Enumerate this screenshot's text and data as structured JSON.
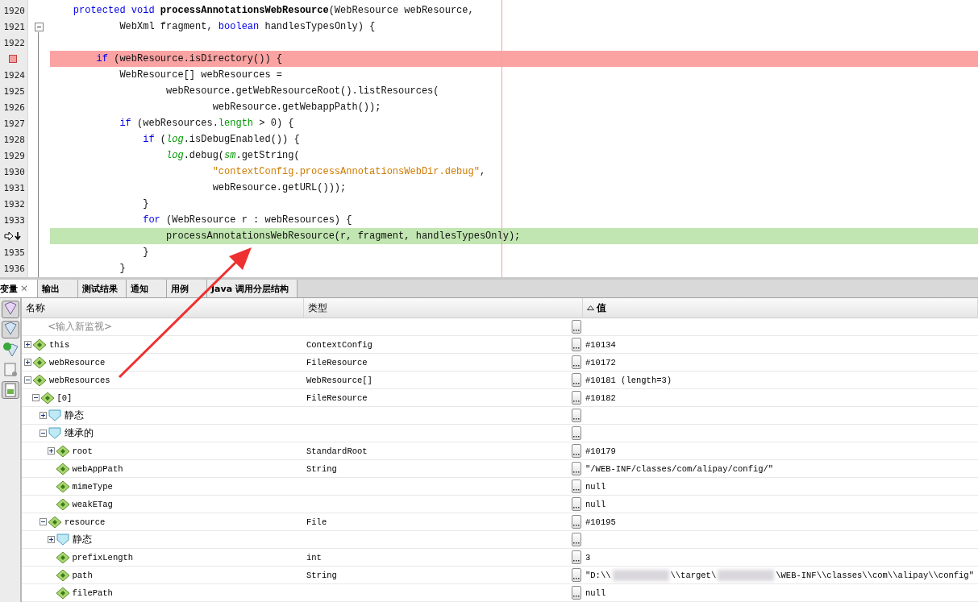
{
  "editor": {
    "lines": [
      {
        "number": "1920",
        "kind": "normal",
        "fold": false,
        "tokens": [
          {
            "kind": "keyword",
            "s": "    protected void "
          },
          {
            "kind": "bold",
            "s": "processAnnotationsWebResource"
          },
          {
            "kind": "plain",
            "s": "(WebResource webResource,"
          }
        ]
      },
      {
        "number": "1921",
        "kind": "normal",
        "fold": true,
        "tokens": [
          {
            "kind": "plain",
            "s": "            WebXml fragment, "
          },
          {
            "kind": "keyword",
            "s": "boolean"
          },
          {
            "kind": "plain",
            "s": " handlesTypesOnly) {"
          }
        ]
      },
      {
        "number": "1922",
        "kind": "normal"
      },
      {
        "kind": "breakpoint",
        "fold": false,
        "tokens": [
          {
            "kind": "keyword",
            "s": "        if"
          },
          {
            "kind": "plain",
            "s": " (webResource.isDirectory()) {"
          }
        ]
      },
      {
        "number": "1924",
        "kind": "normal",
        "fold": false,
        "tokens": [
          {
            "kind": "plain",
            "s": "            WebResource[] webResources ="
          }
        ]
      },
      {
        "number": "1925",
        "kind": "normal",
        "fold": false,
        "tokens": [
          {
            "kind": "plain",
            "s": "                    webResource.getWebResourceRoot().listResources("
          }
        ]
      },
      {
        "number": "1926",
        "kind": "normal",
        "fold": false,
        "tokens": [
          {
            "kind": "plain",
            "s": "                            webResource.getWebappPath());"
          }
        ]
      },
      {
        "number": "1927",
        "kind": "normal",
        "fold": false,
        "tokens": [
          {
            "kind": "keyword",
            "s": "            if"
          },
          {
            "kind": "plain",
            "s": " (webResources."
          },
          {
            "kind": "field",
            "s": "length"
          },
          {
            "kind": "plain",
            "s": " > 0) {"
          }
        ]
      },
      {
        "number": "1928",
        "kind": "normal",
        "fold": false,
        "tokens": [
          {
            "kind": "keyword",
            "s": "                if"
          },
          {
            "kind": "plain",
            "s": " ("
          },
          {
            "kind": "static",
            "s": "log"
          },
          {
            "kind": "plain",
            "s": ".isDebugEnabled()) {"
          }
        ]
      },
      {
        "number": "1929",
        "kind": "normal",
        "fold": false,
        "tokens": [
          {
            "kind": "static",
            "s": "                    log"
          },
          {
            "kind": "plain",
            "s": ".debug("
          },
          {
            "kind": "static",
            "s": "sm"
          },
          {
            "kind": "plain",
            "s": ".getString("
          }
        ]
      },
      {
        "number": "1930",
        "kind": "normal",
        "fold": false,
        "tokens": [
          {
            "kind": "string",
            "s": "                            \"contextConfig.processAnnotationsWebDir.debug\""
          },
          {
            "kind": "plain",
            "s": ","
          }
        ]
      },
      {
        "number": "1931",
        "kind": "normal",
        "fold": false,
        "tokens": [
          {
            "kind": "plain",
            "s": "                            webResource.getURL()));"
          }
        ]
      },
      {
        "number": "1932",
        "kind": "normal",
        "fold": false,
        "tokens": [
          {
            "kind": "plain",
            "s": "                }"
          }
        ]
      },
      {
        "number": "1933",
        "kind": "normal",
        "fold": false,
        "tokens": [
          {
            "kind": "keyword",
            "s": "                for"
          },
          {
            "kind": "plain",
            "s": " (WebResource r : webResources) {"
          }
        ]
      },
      {
        "kind": "current",
        "fold": false,
        "tokens": [
          {
            "kind": "plain",
            "s": "                    processAnnotationsWebResource(r, fragment, handlesTypesOnly);"
          }
        ]
      },
      {
        "number": "1935",
        "kind": "normal",
        "fold": false,
        "tokens": [
          {
            "kind": "plain",
            "s": "                }"
          }
        ]
      },
      {
        "number": "1936",
        "kind": "normal",
        "fold": false,
        "tokens": [
          {
            "kind": "plain",
            "s": "            }"
          }
        ]
      }
    ]
  },
  "tabs": [
    {
      "label": "变量",
      "selected": true,
      "closable": true
    },
    {
      "label": "输出",
      "selected": false,
      "closable": false
    },
    {
      "label": "测试结果",
      "selected": false,
      "closable": false
    },
    {
      "label": "通知",
      "selected": false,
      "closable": false
    },
    {
      "label": "用例",
      "selected": false,
      "closable": false
    },
    {
      "label": "Java 调用分层结构",
      "selected": false,
      "closable": false
    }
  ],
  "table": {
    "columns": [
      {
        "label": "名称",
        "sorted": false
      },
      {
        "label": "类型",
        "sorted": false
      },
      {
        "label": "值",
        "sorted": true
      }
    ],
    "rows": [
      {
        "kind": "new_watch",
        "name": "<输入新监视>"
      },
      {
        "kind": "variable",
        "name": "this",
        "type": "ContextConfig",
        "value": "#10134",
        "expanded": false
      },
      {
        "kind": "variable",
        "name": "webResource",
        "type": "FileResource",
        "value": "#10172",
        "expanded": false
      },
      {
        "kind": "variable",
        "name": "webResources",
        "type": "WebResource[]",
        "value": "#10181 (length=3)",
        "expanded": true,
        "children": [
          {
            "kind": "variable",
            "name": "[0]",
            "type": "FileResource",
            "value": "#10182",
            "expanded": true,
            "children": [
              {
                "kind": "category",
                "name": "静态",
                "expanded": false
              },
              {
                "kind": "category",
                "name": "继承的",
                "expanded": true,
                "children": [
                  {
                    "kind": "variable",
                    "name": "root",
                    "type": "StandardRoot",
                    "value": "#10179",
                    "expanded": false
                  },
                  {
                    "kind": "variable",
                    "name": "webAppPath",
                    "type": "String",
                    "value": "\"/WEB-INF/classes/com/alipay/config/\""
                  },
                  {
                    "kind": "variable",
                    "name": "mimeType",
                    "value": "null"
                  },
                  {
                    "kind": "variable",
                    "name": "weakETag",
                    "value": "null"
                  }
                ]
              },
              {
                "kind": "variable",
                "name": "resource",
                "type": "File",
                "value": "#10195",
                "expanded": true,
                "children": [
                  {
                    "kind": "category",
                    "name": "静态",
                    "expanded": false
                  },
                  {
                    "kind": "variable",
                    "name": "prefixLength",
                    "type": "int",
                    "value": "3"
                  },
                  {
                    "kind": "variable",
                    "name": "path",
                    "type": "String",
                    "value_parts": [
                      "\"D:\\\\",
                      "\\\\target\\",
                      "\\WEB-INF\\\\classes\\\\com\\\\alipay\\\\config\""
                    ]
                  },
                  {
                    "kind": "variable",
                    "name": "filePath",
                    "value": "null"
                  }
                ]
              }
            ]
          }
        ]
      }
    ]
  }
}
